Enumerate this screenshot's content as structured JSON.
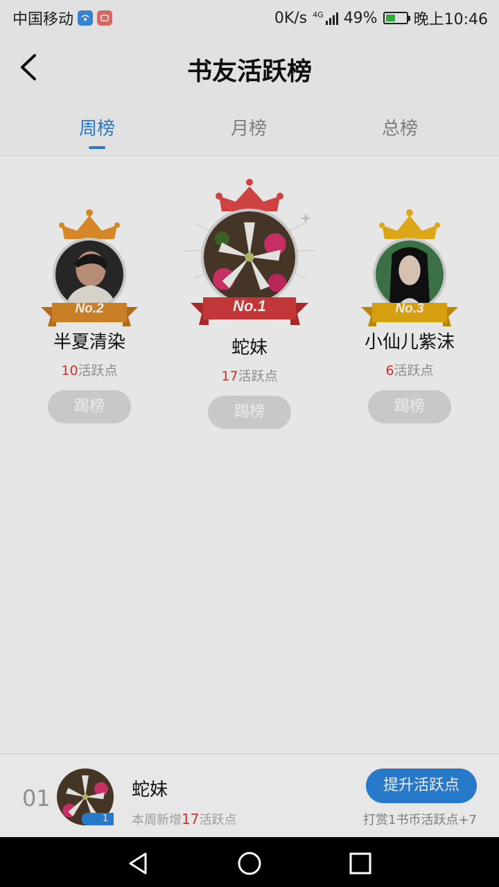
{
  "status_bar": {
    "carrier": "中国移动",
    "network_speed": "0K/s",
    "network_type": "4G",
    "battery_percent": "49%",
    "battery_level": 0.49,
    "time": "晚上10:46"
  },
  "header": {
    "title": "书友活跃榜"
  },
  "tabs": [
    {
      "label": "周榜",
      "active": true
    },
    {
      "label": "月榜",
      "active": false
    },
    {
      "label": "总榜",
      "active": false
    }
  ],
  "podium": [
    {
      "rank_label": "No.2",
      "name": "半夏清染",
      "points": "10",
      "points_suffix": "活跃点",
      "button": "踢榜",
      "crown_color": "#e8922a",
      "ribbon_color": "#d98a2a"
    },
    {
      "rank_label": "No.1",
      "name": "蛇妹",
      "points": "17",
      "points_suffix": "活跃点",
      "button": "踢榜",
      "crown_color": "#e04848",
      "ribbon_color": "#d23c3c"
    },
    {
      "rank_label": "No.3",
      "name": "小仙儿紫沫",
      "points": "6",
      "points_suffix": "活跃点",
      "button": "踢榜",
      "crown_color": "#f0b51a",
      "ribbon_color": "#e8ad12"
    }
  ],
  "my_rank": {
    "rank": "01",
    "name": "蛇妹",
    "badge_level": "1",
    "new_prefix": "本周新增",
    "new_points": "17",
    "new_suffix": "活跃点",
    "boost_button": "提升活跃点",
    "reward_text": "打赏1书币活跃点+7"
  },
  "colors": {
    "accent": "#2b84db",
    "points_red": "#d33333"
  }
}
